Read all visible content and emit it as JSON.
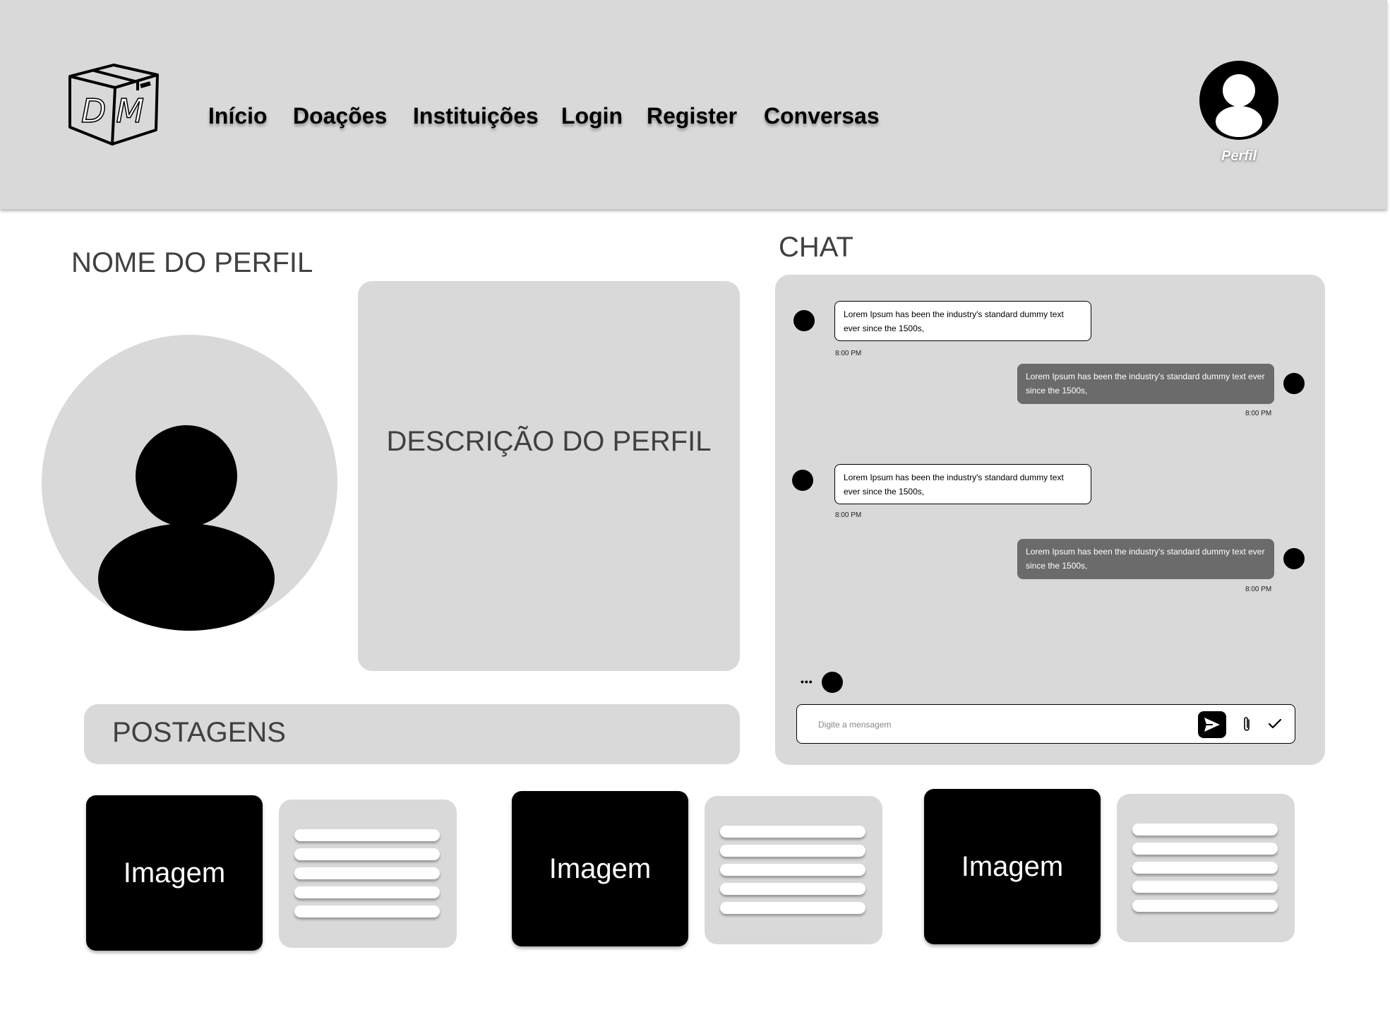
{
  "header": {
    "logo_letters": "DM",
    "nav": [
      "Início",
      "Doações",
      "Instituições",
      "Login",
      "Register",
      "Conversas"
    ],
    "profile_label": "Perfil"
  },
  "profile": {
    "name": "NOME DO PERFIL",
    "description": "DESCRIÇÃO DO PERFIL"
  },
  "posts": {
    "title": "POSTAGENS",
    "items": [
      {
        "image_label": "Imagem"
      },
      {
        "image_label": "Imagem"
      },
      {
        "image_label": "Imagem"
      }
    ]
  },
  "chat": {
    "title": "CHAT",
    "messages": [
      {
        "side": "in",
        "text": "Lorem Ipsum has been the industry's standard dummy text ever since the 1500s,",
        "time": "8:00 PM"
      },
      {
        "side": "out",
        "text": "Lorem Ipsum has been the industry's standard dummy text ever since the 1500s,",
        "time": "8:00 PM"
      },
      {
        "side": "in",
        "text": "Lorem Ipsum has been the industry's standard dummy text ever since the 1500s,",
        "time": "8:00 PM"
      },
      {
        "side": "out",
        "text": "Lorem Ipsum has been the industry's standard dummy text ever since the 1500s,",
        "time": "8:00 PM"
      }
    ],
    "typing": "•••",
    "input_placeholder": "Digite a mensagem"
  }
}
